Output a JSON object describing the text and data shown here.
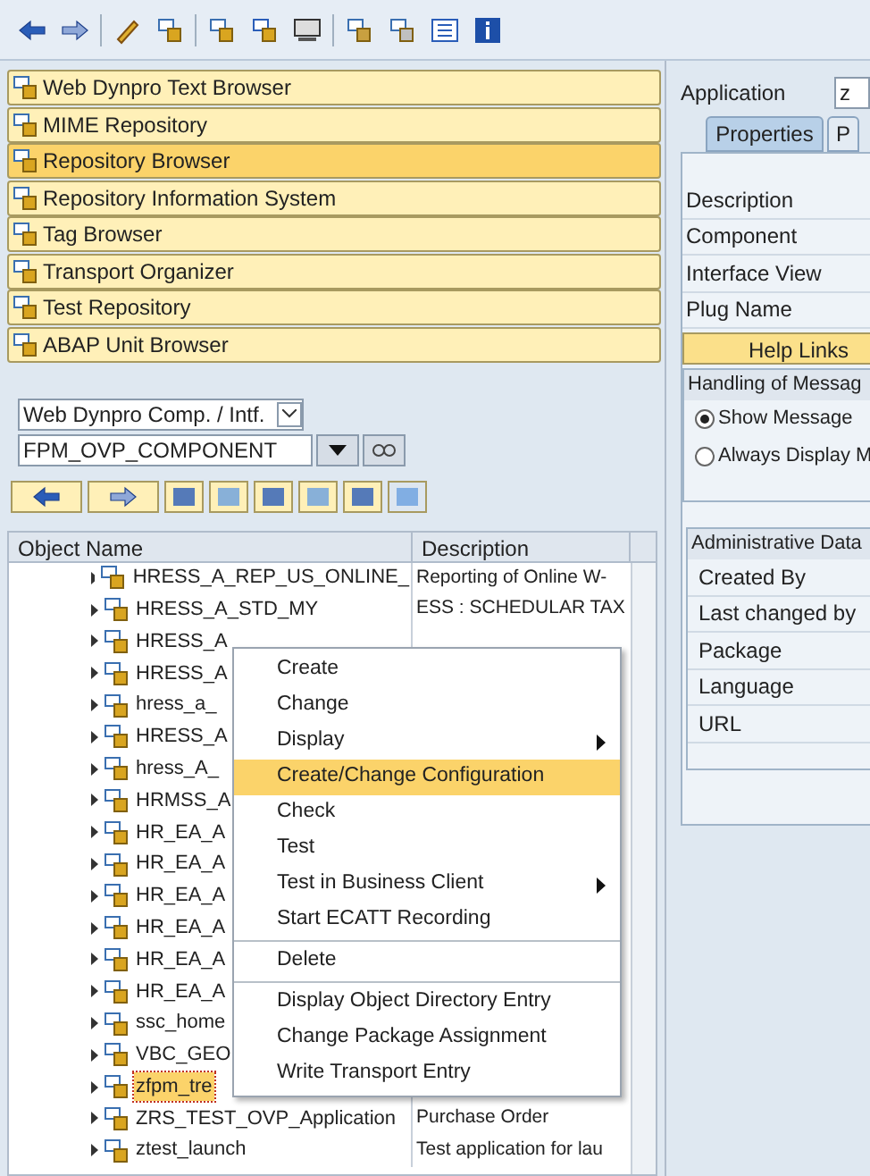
{
  "nav_buttons": [
    {
      "label": "Web Dynpro Text Browser",
      "selected": false
    },
    {
      "label": "MIME Repository",
      "selected": false
    },
    {
      "label": "Repository Browser",
      "selected": true
    },
    {
      "label": "Repository Information System",
      "selected": false
    },
    {
      "label": "Tag Browser",
      "selected": false
    },
    {
      "label": "Transport Organizer",
      "selected": false
    },
    {
      "label": "Test Repository",
      "selected": false
    },
    {
      "label": "ABAP Unit Browser",
      "selected": false
    }
  ],
  "object_type": {
    "value": "Web Dynpro Comp. / Intf."
  },
  "object_name": {
    "value": "FPM_OVP_COMPONENT"
  },
  "tree": {
    "columns": [
      "Object Name",
      "Description"
    ],
    "rows": [
      {
        "name": "HRESS_A_REP_US_ONLINE_",
        "description": "Reporting of Online W-",
        "selected": false
      },
      {
        "name": "HRESS_A_STD_MY",
        "description": "ESS : SCHEDULAR TAX",
        "selected": false
      },
      {
        "name": "HRESS_A",
        "selected": false
      },
      {
        "name": "HRESS_A",
        "selected": false
      },
      {
        "name": "hress_a_",
        "selected": false
      },
      {
        "name": "HRESS_A",
        "selected": false
      },
      {
        "name": "hress_A_",
        "selected": false
      },
      {
        "name": "HRMSS_A",
        "selected": false
      },
      {
        "name": "HR_EA_A",
        "selected": false
      },
      {
        "name": "HR_EA_A",
        "selected": false
      },
      {
        "name": "HR_EA_A",
        "selected": false
      },
      {
        "name": "HR_EA_A",
        "selected": false
      },
      {
        "name": "HR_EA_A",
        "selected": false
      },
      {
        "name": "HR_EA_A",
        "selected": false
      },
      {
        "name": "ssc_home",
        "selected": false
      },
      {
        "name": "VBC_GEO",
        "selected": false
      },
      {
        "name": "zfpm_tre",
        "selected": true
      },
      {
        "name": "ZRS_TEST_OVP_Application",
        "description": "Purchase Order",
        "selected": false
      },
      {
        "name": "ztest_launch",
        "description": "Test application for lau",
        "selected": false
      }
    ]
  },
  "context_menu": [
    {
      "kind": "item",
      "label": "Create",
      "submenu": false,
      "selected": false
    },
    {
      "kind": "item",
      "label": "Change",
      "submenu": false,
      "selected": false
    },
    {
      "kind": "item",
      "label": "Display",
      "submenu": true,
      "selected": false
    },
    {
      "kind": "item",
      "label": "Create/Change Configuration",
      "submenu": false,
      "selected": true
    },
    {
      "kind": "item",
      "label": "Check",
      "submenu": false,
      "selected": false
    },
    {
      "kind": "item",
      "label": "Test",
      "submenu": false,
      "selected": false
    },
    {
      "kind": "item",
      "label": "Test in Business Client",
      "submenu": true,
      "selected": false
    },
    {
      "kind": "item",
      "label": "Start ECATT Recording",
      "submenu": false,
      "selected": false
    },
    {
      "kind": "separator"
    },
    {
      "kind": "item",
      "label": "Delete",
      "submenu": false,
      "selected": false
    },
    {
      "kind": "separator"
    },
    {
      "kind": "item",
      "label": "Display Object Directory Entry",
      "submenu": false,
      "selected": false
    },
    {
      "kind": "item",
      "label": "Change Package Assignment",
      "submenu": false,
      "selected": false
    },
    {
      "kind": "item",
      "label": "Write Transport Entry",
      "submenu": false,
      "selected": false
    }
  ],
  "right_panel": {
    "application_label": "Application",
    "application_value": "z",
    "tabs": [
      {
        "label": "Properties",
        "selected": true
      },
      {
        "label": "P",
        "selected": false
      }
    ],
    "fields": [
      "Description",
      "Component",
      "Interface View",
      "Plug Name"
    ],
    "help_button": "Help Links",
    "messages_group": {
      "title": "Handling of Messag",
      "options": [
        {
          "label": "Show Message",
          "selected": true
        },
        {
          "label": "Always Display M",
          "selected": false
        }
      ]
    },
    "admin_group": {
      "title": "Administrative Data",
      "fields": [
        "Created By",
        "Last changed by",
        "Package",
        "Language",
        "URL"
      ]
    }
  }
}
